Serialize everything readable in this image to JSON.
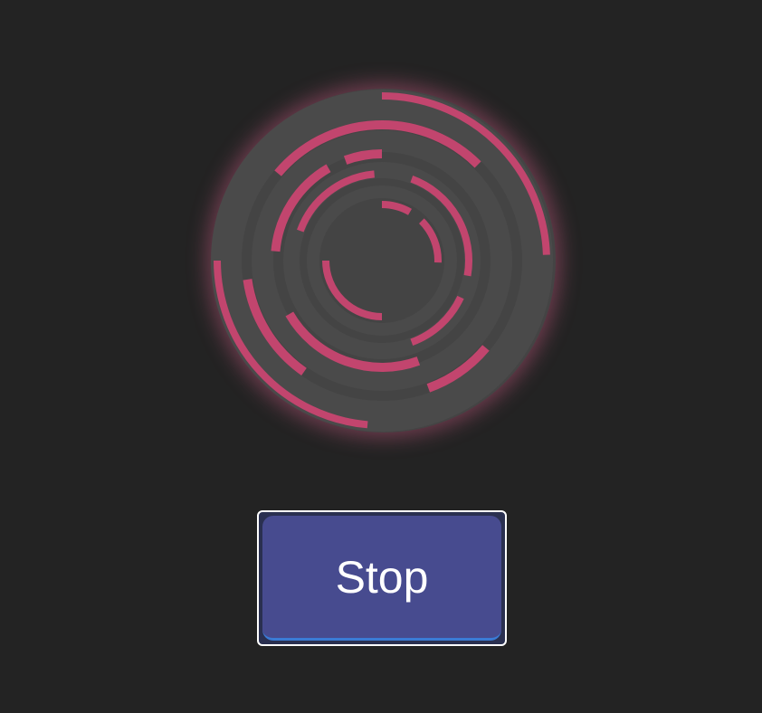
{
  "spinner": {
    "icon": "concentric-rings-spinner-icon",
    "ring_color": "#4a4a4a",
    "arc_color": "#c2456e",
    "glow_color": "#c95a82"
  },
  "button": {
    "label": "Stop",
    "fill_color": "#474b8f",
    "border_color": "#ffffff"
  }
}
